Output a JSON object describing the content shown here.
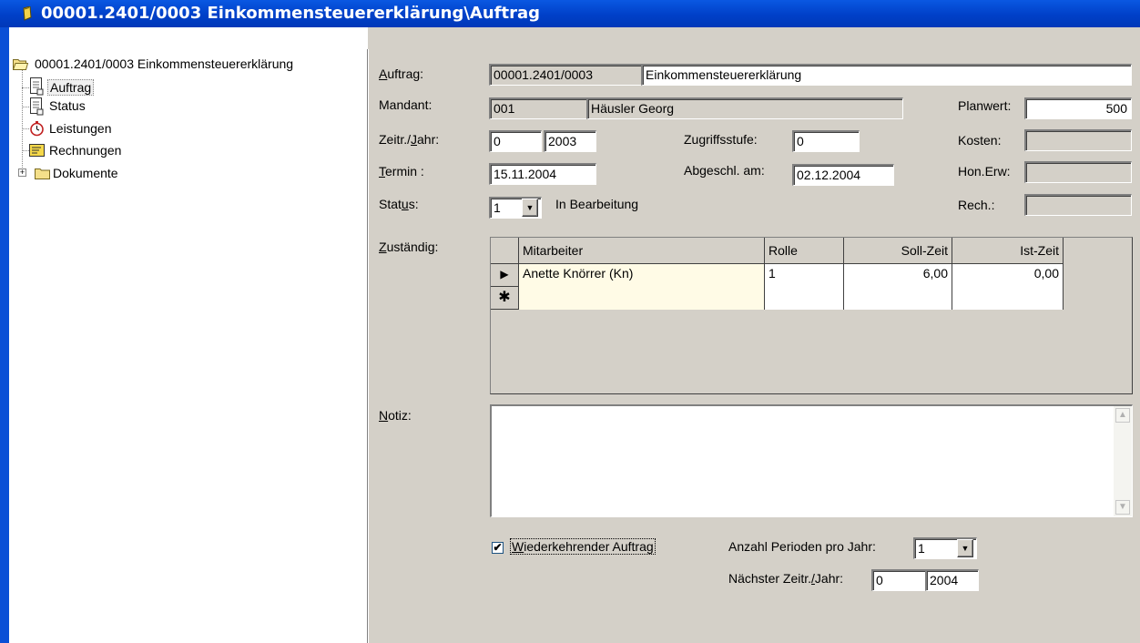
{
  "window": {
    "title": "00001.2401/0003 Einkommensteuererklärung\\Auftrag"
  },
  "tree": {
    "root": "00001.2401/0003 Einkommensteuererklärung",
    "items": [
      {
        "label": "Auftrag",
        "icon": "document-icon"
      },
      {
        "label": "Status",
        "icon": "document-icon"
      },
      {
        "label": "Leistungen",
        "icon": "stopwatch-icon"
      },
      {
        "label": "Rechnungen",
        "icon": "invoice-icon"
      },
      {
        "label": "Dokumente",
        "icon": "folder-icon"
      }
    ]
  },
  "form": {
    "auftrag_label": "Auftrag:",
    "auftrag_nr": "00001.2401/0003",
    "auftrag_name": "Einkommensteuererklärung",
    "mandant_label": "Mandant:",
    "mandant_nr": "001",
    "mandant_name": "Häusler Georg",
    "planwert_label": "Planwert:",
    "planwert": "500",
    "zeitr_label": "Zeitr./Jahr:",
    "zeitr": "0",
    "jahr": "2003",
    "zugriff_label": "Zugriffsstufe:",
    "zugriff": "0",
    "kosten_label": "Kosten:",
    "kosten": "",
    "termin_label": "Termin :",
    "termin": "15.11.2004",
    "abgeschl_label": "Abgeschl. am:",
    "abgeschl": "02.12.2004",
    "honerw_label": "Hon.Erw:",
    "honerw": "",
    "status_label": "Status:",
    "status_value": "1",
    "status_text": "In Bearbeitung",
    "rech_label": "Rech.:",
    "rech": "",
    "zustaendig_label": "Zuständig:",
    "notiz_label": "Notiz:",
    "notiz": "",
    "wiederkehrend_label": "Wiederkehrender Auftrag",
    "wiederkehrend_checked": true,
    "perioden_label": "Anzahl Perioden pro Jahr:",
    "perioden": "1",
    "naechster_label": "Nächster Zeitr./Jahr:",
    "naechster_zeitr": "0",
    "naechster_jahr": "2004"
  },
  "grid": {
    "columns": [
      "Mitarbeiter",
      "Rolle",
      "Soll-Zeit",
      "Ist-Zeit"
    ],
    "rows": [
      {
        "mitarbeiter": "Anette Knörrer (Kn)",
        "rolle": "1",
        "soll": "6,00",
        "ist": "0,00"
      }
    ]
  },
  "colors": {
    "titlebar": "#0a58e2",
    "selected_row": "#fffbe6",
    "face": "#d4d0c8"
  }
}
